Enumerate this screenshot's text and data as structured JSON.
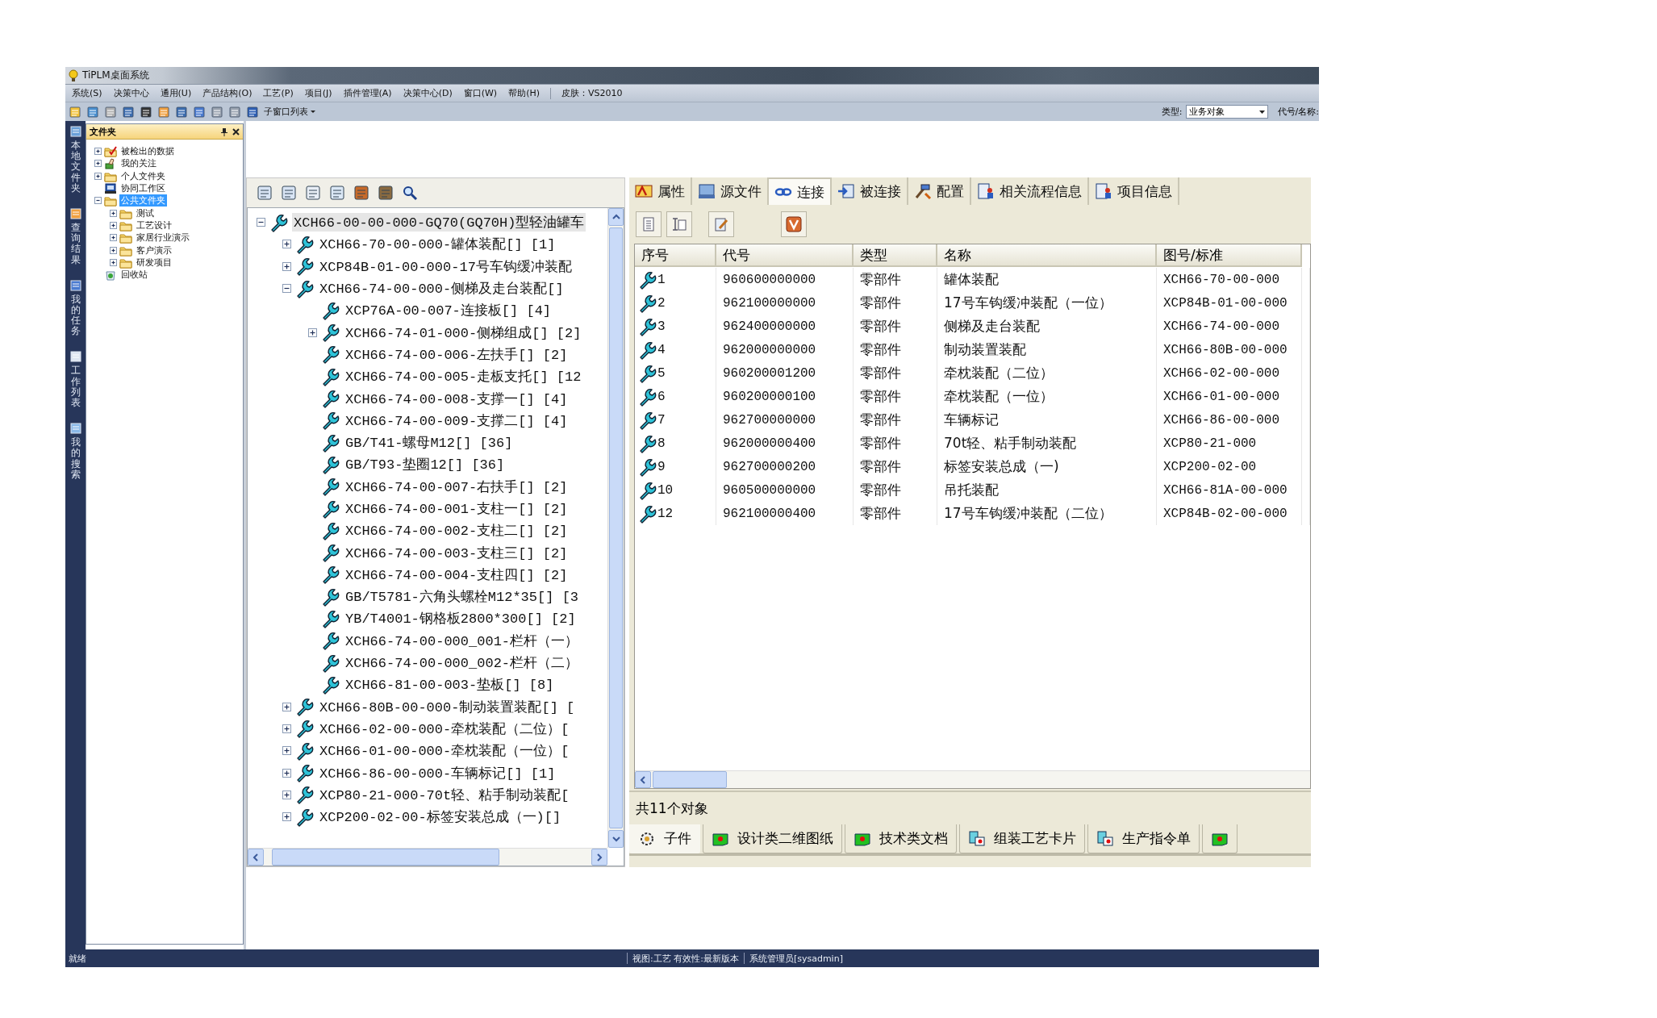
{
  "window": {
    "title": "TiPLM桌面系统"
  },
  "menu": [
    "系统(S)",
    "决策中心",
    "通用(U)",
    "产品结构(O)",
    "工艺(P)",
    "项目(J)",
    "插件管理(A)",
    "决策中心(D)",
    "窗口(W)",
    "帮助(H)"
  ],
  "skin": "皮肤：VS2010",
  "toolbar": {
    "window_list": "子窗口列表",
    "type_label": "类型:",
    "type_value": "业务对象",
    "code_label": "代号/名称:"
  },
  "side_nav": [
    "本地文件夹",
    "查询结果",
    "我的任务",
    "工作列表",
    "我的搜索"
  ],
  "folder_panel": {
    "title": "文件夹",
    "items": [
      {
        "label": "被检出的数据",
        "expanded": false,
        "selected": false
      },
      {
        "label": "我的关注",
        "expanded": false,
        "selected": false
      },
      {
        "label": "个人文件夹",
        "expanded": false,
        "selected": false
      },
      {
        "label": "协同工作区",
        "selected": false
      },
      {
        "label": "公共文件夹",
        "expanded": true,
        "selected": true,
        "children": [
          {
            "label": "测试",
            "expanded": false,
            "selected": false
          },
          {
            "label": "工艺设计",
            "expanded": false,
            "selected": false
          },
          {
            "label": "家居行业演示",
            "expanded": false,
            "selected": false
          },
          {
            "label": "客户演示",
            "expanded": false,
            "selected": false
          },
          {
            "label": "研发项目",
            "expanded": false,
            "selected": false
          }
        ]
      },
      {
        "label": "回收站",
        "selected": false
      }
    ]
  },
  "part_tree": {
    "nodes": [
      {
        "label": "XCH66-00-00-000-GQ70(GQ70H)型轻油罐车",
        "expanded": true,
        "selected": true,
        "children": [
          {
            "label": "XCH66-70-00-000-罐体装配[] [1]",
            "expanded": false,
            "selected": false
          },
          {
            "label": "XCP84B-01-00-000-17号车钩缓冲装配",
            "expanded": false,
            "selected": false
          },
          {
            "label": "XCH66-74-00-000-侧梯及走台装配[]",
            "expanded": true,
            "selected": false,
            "children": [
              {
                "label": "XCP76A-00-007-连接板[] [4]",
                "selected": false
              },
              {
                "label": "XCH66-74-01-000-侧梯组成[] [2]",
                "expanded": false,
                "selected": false
              },
              {
                "label": "XCH66-74-00-006-左扶手[] [2]",
                "selected": false
              },
              {
                "label": "XCH66-74-00-005-走板支托[] [12",
                "selected": false
              },
              {
                "label": "XCH66-74-00-008-支撑一[] [4]",
                "selected": false
              },
              {
                "label": "XCH66-74-00-009-支撑二[] [4]",
                "selected": false
              },
              {
                "label": "GB/T41-螺母M12[] [36]",
                "selected": false
              },
              {
                "label": "GB/T93-垫圈12[] [36]",
                "selected": false
              },
              {
                "label": "XCH66-74-00-007-右扶手[] [2]",
                "selected": false
              },
              {
                "label": "XCH66-74-00-001-支柱一[] [2]",
                "selected": false
              },
              {
                "label": "XCH66-74-00-002-支柱二[] [2]",
                "selected": false
              },
              {
                "label": "XCH66-74-00-003-支柱三[] [2]",
                "selected": false
              },
              {
                "label": "XCH66-74-00-004-支柱四[] [2]",
                "selected": false
              },
              {
                "label": "GB/T5781-六角头螺栓M12*35[] [3",
                "selected": false
              },
              {
                "label": "YB/T4001-钢格板2800*300[] [2]",
                "selected": false
              },
              {
                "label": "XCH66-74-00-000_001-栏杆（一）",
                "selected": false
              },
              {
                "label": "XCH66-74-00-000_002-栏杆（二）",
                "selected": false
              },
              {
                "label": "XCH66-81-00-003-垫板[] [8]",
                "selected": false
              }
            ]
          },
          {
            "label": "XCH66-80B-00-000-制动装置装配[] [",
            "expanded": false,
            "selected": false
          },
          {
            "label": "XCH66-02-00-000-牵枕装配（二位）[",
            "expanded": false,
            "selected": false
          },
          {
            "label": "XCH66-01-00-000-牵枕装配（一位）[",
            "expanded": false,
            "selected": false
          },
          {
            "label": "XCH66-86-00-000-车辆标记[] [1]",
            "expanded": false,
            "selected": false
          },
          {
            "label": "XCP80-21-000-70t轻、粘手制动装配[",
            "expanded": false,
            "selected": false
          },
          {
            "label": "XCP200-02-00-标签安装总成（一)[]",
            "expanded": false,
            "selected": false
          }
        ]
      }
    ]
  },
  "detail_tabs": [
    {
      "label": "属性",
      "selected": false
    },
    {
      "label": "源文件",
      "selected": false
    },
    {
      "label": "连接",
      "selected": true
    },
    {
      "label": "被连接",
      "selected": false
    },
    {
      "label": "配置",
      "selected": false
    },
    {
      "label": "相关流程信息",
      "selected": false
    },
    {
      "label": "项目信息",
      "selected": false
    }
  ],
  "links_table": {
    "columns": [
      "序号",
      "代号",
      "类型",
      "名称",
      "图号/标准"
    ],
    "rows": [
      {
        "no": "1",
        "code": "960600000000",
        "type": "零部件",
        "name": "罐体装配",
        "drawing": "XCH66-70-00-000"
      },
      {
        "no": "2",
        "code": "962100000000",
        "type": "零部件",
        "name": "17号车钩缓冲装配（一位）",
        "drawing": "XCP84B-01-00-000"
      },
      {
        "no": "3",
        "code": "962400000000",
        "type": "零部件",
        "name": "侧梯及走台装配",
        "drawing": "XCH66-74-00-000"
      },
      {
        "no": "4",
        "code": "962000000000",
        "type": "零部件",
        "name": "制动装置装配",
        "drawing": "XCH66-80B-00-000"
      },
      {
        "no": "5",
        "code": "960200001200",
        "type": "零部件",
        "name": "牵枕装配（二位）",
        "drawing": "XCH66-02-00-000"
      },
      {
        "no": "6",
        "code": "960200000100",
        "type": "零部件",
        "name": "牵枕装配（一位）",
        "drawing": "XCH66-01-00-000"
      },
      {
        "no": "7",
        "code": "962700000000",
        "type": "零部件",
        "name": "车辆标记",
        "drawing": "XCH66-86-00-000"
      },
      {
        "no": "8",
        "code": "962000000400",
        "type": "零部件",
        "name": "70t轻、粘手制动装配",
        "drawing": "XCP80-21-000"
      },
      {
        "no": "9",
        "code": "962700000200",
        "type": "零部件",
        "name": "标签安装总成（一)",
        "drawing": "XCP200-02-00"
      },
      {
        "no": "10",
        "code": "960500000000",
        "type": "零部件",
        "name": "吊托装配",
        "drawing": "XCH66-81A-00-000"
      },
      {
        "no": "12",
        "code": "962100000400",
        "type": "零部件",
        "name": "17号车钩缓冲装配（二位）",
        "drawing": "XCP84B-02-00-000"
      }
    ]
  },
  "object_count": "共11个对象",
  "child_tabs": [
    {
      "label": "子件",
      "selected": true
    },
    {
      "label": "设计类二维图纸",
      "selected": false
    },
    {
      "label": "技术类文档",
      "selected": false
    },
    {
      "label": "组装工艺卡片",
      "selected": false
    },
    {
      "label": "生产指令单",
      "selected": false
    },
    {
      "selected": false
    }
  ],
  "status_bar": {
    "state": "就绪",
    "view": "视图:工艺 有效性:最新版本",
    "user": "系统管理员[sysadmin]"
  }
}
